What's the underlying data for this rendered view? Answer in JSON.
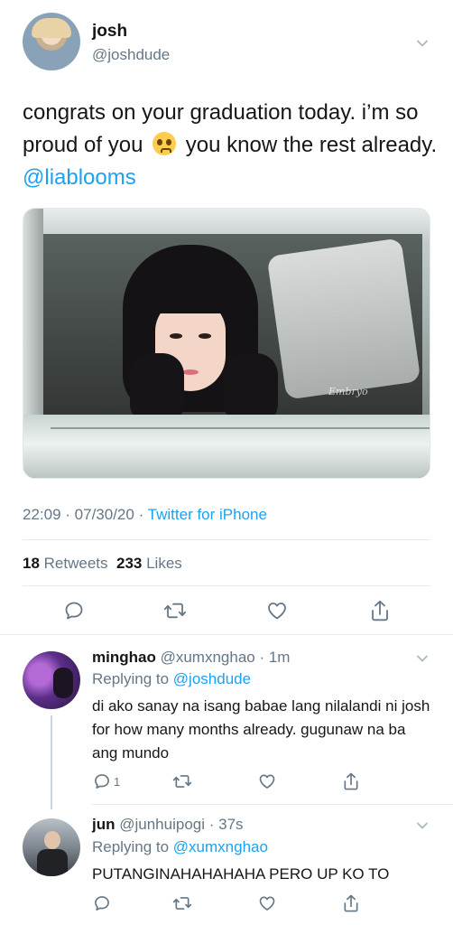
{
  "main_tweet": {
    "name": "josh",
    "handle": "@joshdude",
    "text_part1": "congrats on your graduation today. i’m so proud of you",
    "emoji": "pleading-face-emoji",
    "text_part2": "you know the rest already.",
    "mention": "@liablooms",
    "image_signature": "Embryo",
    "time": "22:09",
    "date": "07/30/20",
    "source": "Twitter for iPhone",
    "retweets_count": "18",
    "retweets_label": "Retweets",
    "likes_count": "233",
    "likes_label": "Likes"
  },
  "replies": [
    {
      "name": "minghao",
      "handle": "@xumxnghao",
      "time": "1m",
      "replying_label": "Replying to",
      "replying_to": "@joshdude",
      "text": "di ako sanay na isang babae lang nilalandi ni josh for how many months already. gugunaw na ba ang mundo",
      "reply_count": "1"
    },
    {
      "name": "jun",
      "handle": "@junhuipogi",
      "time": "37s",
      "replying_label": "Replying to",
      "replying_to": "@xumxnghao",
      "text": "PUTANGINAHAHAHAHA PERO UP KO TO",
      "reply_count": ""
    }
  ],
  "icons": {
    "reply": "reply-icon",
    "retweet": "retweet-icon",
    "like": "heart-icon",
    "share": "share-icon",
    "more": "chevron-down-icon"
  },
  "colors": {
    "accent": "#1da1f2",
    "secondary_text": "#657786",
    "divider": "#e6ecf0"
  }
}
